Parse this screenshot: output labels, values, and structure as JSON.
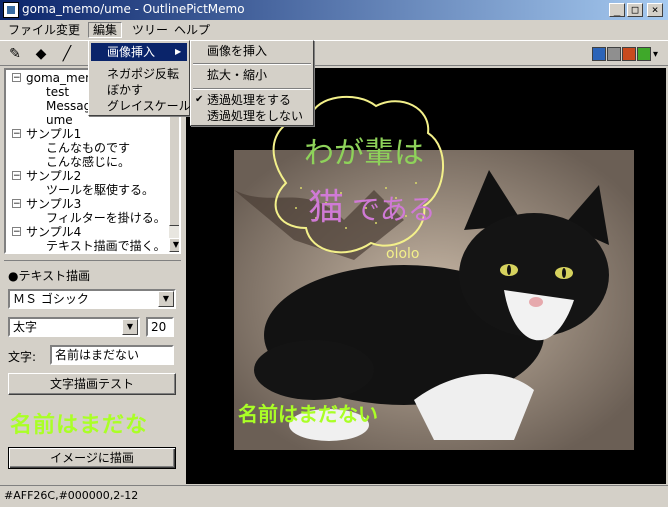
{
  "window": {
    "title": "goma_memo/ume - OutlinePictMemo",
    "min": "_",
    "max": "□",
    "close": "×"
  },
  "menubar": [
    "ファイル",
    "変更",
    "編集",
    "ツリー",
    "ヘルプ"
  ],
  "edit_menu": {
    "items": [
      "画像挿入",
      "ネガポジ反転",
      "ぼかす",
      "グレイスケール"
    ],
    "submenu_arrow": "▶"
  },
  "image_submenu": {
    "items": [
      "画像を挿入",
      "拡大・縮小",
      "透過処理をする",
      "透過処理をしない"
    ],
    "check": "✔"
  },
  "toolbar": {
    "icons": [
      "pencil-icon",
      "eraser-icon",
      "line-icon"
    ],
    "colors": [
      "#2c64b8",
      "#8f8f8f",
      "#c84a1e",
      "#3fa82a"
    ],
    "dropdown": "▾"
  },
  "tree": {
    "nodes": [
      {
        "label": "goma_memo",
        "level": 0,
        "toggle": "−"
      },
      {
        "label": "test",
        "level": 1
      },
      {
        "label": "Message",
        "level": 1
      },
      {
        "label": "ume",
        "level": 1
      },
      {
        "label": "サンプル1",
        "level": 0,
        "toggle": "−"
      },
      {
        "label": "こんなものです",
        "level": 1
      },
      {
        "label": "こんな感じに。",
        "level": 1
      },
      {
        "label": "サンプル2",
        "level": 0,
        "toggle": "−"
      },
      {
        "label": "ツールを駆使する。",
        "level": 1
      },
      {
        "label": "サンプル3",
        "level": 0,
        "toggle": "−"
      },
      {
        "label": "フィルターを掛ける。",
        "level": 1
      },
      {
        "label": "サンプル4",
        "level": 0,
        "toggle": "−"
      },
      {
        "label": "テキスト描画で描く。",
        "level": 1
      }
    ],
    "scroll_up": "▲",
    "scroll_down": "▼"
  },
  "text_panel": {
    "heading": "●テキスト描画",
    "font_value": "ＭＳ ゴシック",
    "style_value": "太字",
    "size_value": "20",
    "text_label": "文字:",
    "text_value": "名前はまだない",
    "test_button": "文字描画テスト",
    "preview": "名前はまだな",
    "draw_button": "イメージに描画",
    "dropdown": "▼"
  },
  "canvas": {
    "bubble_line1": "わが輩は",
    "bubble_line2_a": "猫",
    "bubble_line2_b": "である",
    "bubble_tail": "ololo",
    "overlay_text": "名前はまだない"
  },
  "statusbar": {
    "text": "#AFF26C,#000000,2-12"
  }
}
